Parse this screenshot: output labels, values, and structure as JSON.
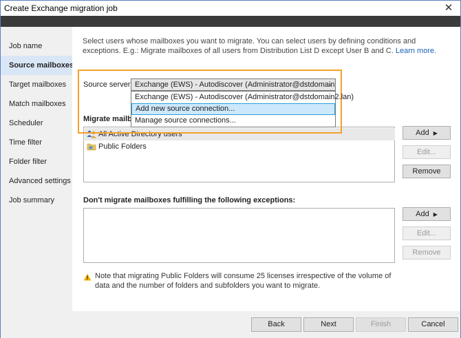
{
  "window": {
    "title": "Create Exchange migration job",
    "close_glyph": "✕"
  },
  "sidebar": {
    "items": [
      {
        "label": "Job name"
      },
      {
        "label": "Source mailboxes",
        "active": true
      },
      {
        "label": "Target mailboxes"
      },
      {
        "label": "Match mailboxes"
      },
      {
        "label": "Scheduler"
      },
      {
        "label": "Time filter"
      },
      {
        "label": "Folder filter"
      },
      {
        "label": "Advanced settings"
      },
      {
        "label": "Job summary"
      }
    ]
  },
  "main": {
    "intro_text": "Select users whose mailboxes you want to migrate. You can select users by defining conditions and exceptions. E.g.: Migrate mailboxes of all users from Distribution List D except User B and C.",
    "learn_more": "Learn more.",
    "source_server": {
      "label": "Source server:",
      "value": "Exchange (EWS) - Autodiscover (Administrator@dstdomain2.lar",
      "options": [
        "Exchange (EWS) - Autodiscover (Administrator@dstdomain2.lan)",
        "Add new source connection...",
        "Manage source connections..."
      ]
    },
    "migrate_label": "Migrate mailbo",
    "migrate_list": [
      {
        "label": "All Active Directory users",
        "icon": "users-icon",
        "selected": true
      },
      {
        "label": "Public Folders",
        "icon": "folder-icon",
        "selected": false
      }
    ],
    "migrate_buttons": {
      "add": "Add",
      "edit": "Edit...",
      "remove": "Remove"
    },
    "exceptions_title": "Don't migrate mailboxes fulfilling the following exceptions:",
    "exception_buttons": {
      "add": "Add",
      "edit": "Edit...",
      "remove": "Remove"
    },
    "note": "Note that migrating Public Folders will consume 25 licenses irrespective of the volume of data and the number of folders and subfolders you want to migrate."
  },
  "footer": {
    "back": "Back",
    "next": "Next",
    "finish": "Finish",
    "cancel": "Cancel"
  },
  "colors": {
    "accent": "#f5a02a",
    "selection": "#d9e6f5",
    "link": "#1a5fb4"
  }
}
